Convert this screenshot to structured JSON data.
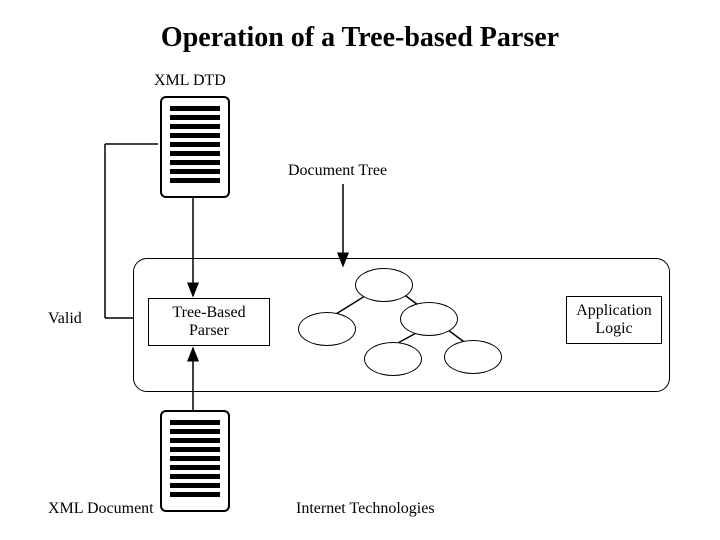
{
  "title": "Operation of a Tree-based Parser",
  "labels": {
    "xml_dtd": "XML DTD",
    "document_tree": "Document Tree",
    "valid": "Valid",
    "tree_based_parser_l1": "Tree-Based",
    "tree_based_parser_l2": "Parser",
    "application_logic_l1": "Application",
    "application_logic_l2": "Logic",
    "xml_document": "XML Document",
    "footer": "Internet Technologies"
  }
}
